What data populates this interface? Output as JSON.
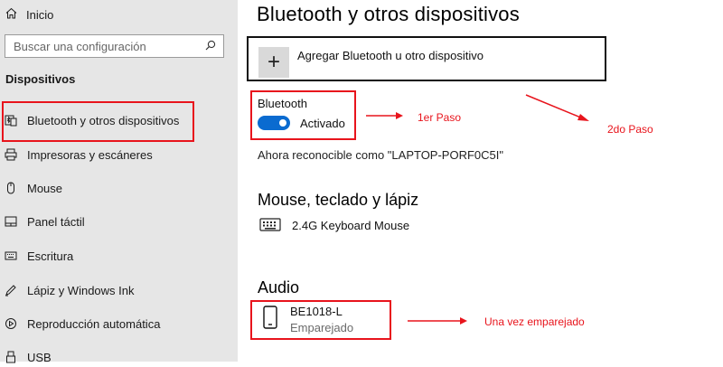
{
  "sidebar": {
    "home_label": "Inicio",
    "search_placeholder": "Buscar una configuración",
    "section_label": "Dispositivos",
    "items": [
      {
        "label": "Bluetooth y otros dispositivos",
        "icon": "bluetooth-devices-icon"
      },
      {
        "label": "Impresoras y escáneres",
        "icon": "printer-icon"
      },
      {
        "label": "Mouse",
        "icon": "mouse-icon"
      },
      {
        "label": "Panel táctil",
        "icon": "touchpad-icon"
      },
      {
        "label": "Escritura",
        "icon": "keyboard-icon"
      },
      {
        "label": "Lápiz y Windows Ink",
        "icon": "pen-icon"
      },
      {
        "label": "Reproducción automática",
        "icon": "autoplay-icon"
      },
      {
        "label": "USB",
        "icon": "usb-icon"
      }
    ]
  },
  "main": {
    "title": "Bluetooth y otros dispositivos",
    "add_device_label": "Agregar Bluetooth u otro dispositivo",
    "bluetooth_heading": "Bluetooth",
    "bluetooth_toggle": {
      "state_label": "Activado",
      "on": true
    },
    "discoverable_text": "Ahora reconocible como \"LAPTOP-PORF0C5I\"",
    "mouse_section": {
      "heading": "Mouse, teclado y lápiz",
      "device_name": "2.4G Keyboard Mouse"
    },
    "audio_section": {
      "heading": "Audio",
      "device_name": "BE1018-L",
      "device_status": "Emparejado"
    }
  },
  "annotations": {
    "step1": "1er Paso",
    "step2": "2do Paso",
    "paired_note": "Una vez emparejado",
    "color": "#e8141c"
  }
}
